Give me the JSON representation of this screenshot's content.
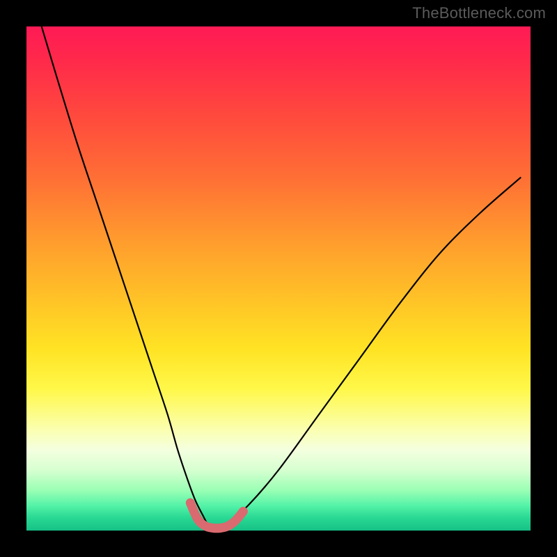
{
  "watermark": "TheBottleneck.com",
  "chart_data": {
    "type": "line",
    "title": "",
    "xlabel": "",
    "ylabel": "",
    "xlim": [
      0,
      100
    ],
    "ylim": [
      0,
      100
    ],
    "grid": false,
    "legend": false,
    "background": "red-yellow-green vertical gradient",
    "series": [
      {
        "name": "bottleneck-curve",
        "color": "#000000",
        "x": [
          3,
          6,
          10,
          14,
          18,
          22,
          25,
          28,
          30,
          32,
          33.5,
          35,
          36,
          37,
          38,
          40,
          44,
          50,
          58,
          66,
          74,
          82,
          90,
          98
        ],
        "y": [
          100,
          90,
          77,
          65,
          53,
          41,
          32,
          23,
          16,
          10,
          6,
          3,
          1.2,
          0.6,
          0.6,
          1.5,
          5,
          12,
          23,
          34,
          45,
          55,
          63,
          70
        ]
      },
      {
        "name": "optimal-range-marker",
        "color": "#d96a6f",
        "x": [
          32.5,
          34,
          35.5,
          37,
          38.5,
          40,
          41.5,
          43
        ],
        "y": [
          5.5,
          2.2,
          0.9,
          0.5,
          0.5,
          0.9,
          2.0,
          3.8
        ]
      }
    ],
    "annotations": [
      {
        "text": "TheBottleneck.com",
        "position": "top-right",
        "role": "watermark"
      }
    ]
  }
}
